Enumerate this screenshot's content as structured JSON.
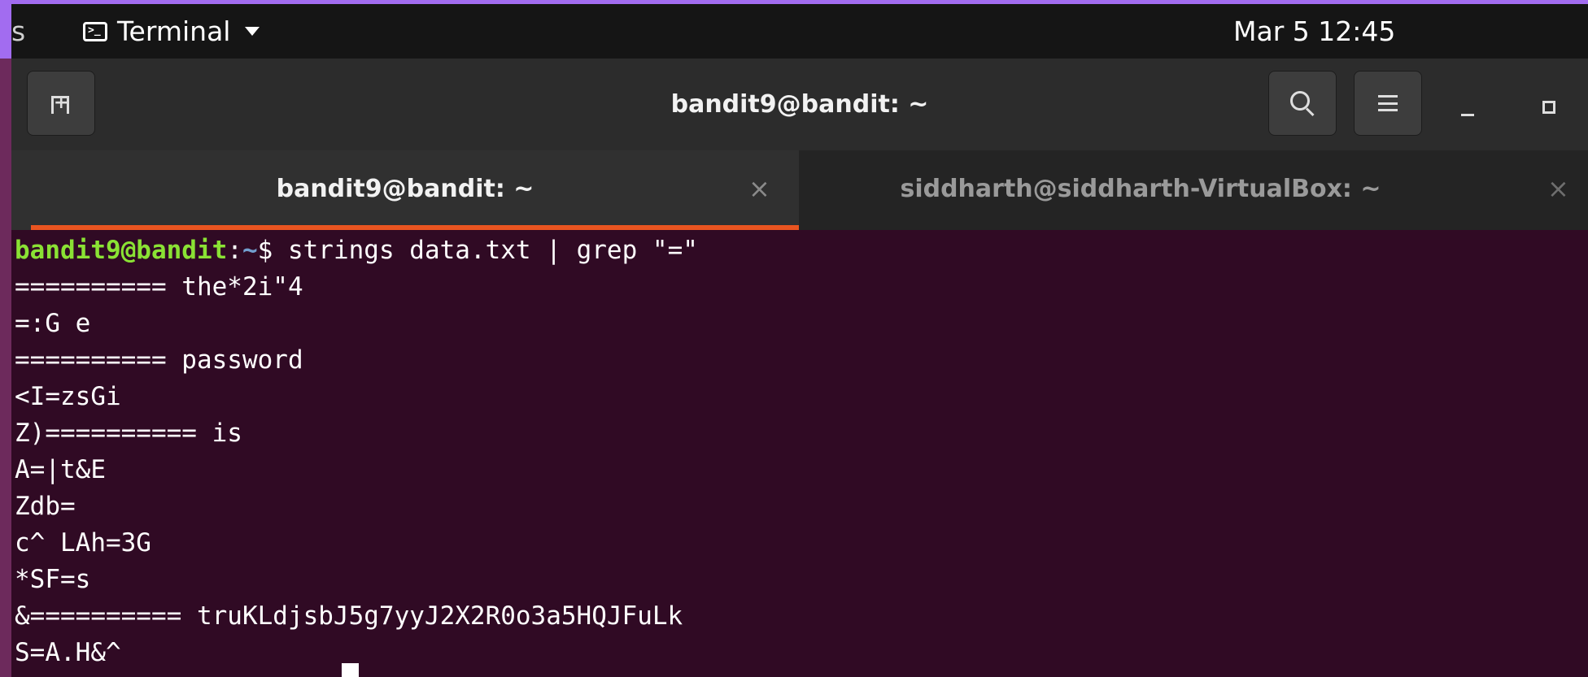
{
  "top_panel": {
    "edge_text": "s",
    "app_menu_label": "Terminal",
    "clock": "Mar 5  12:45"
  },
  "window": {
    "title": "bandit9@bandit: ~"
  },
  "tabs": [
    {
      "label": "bandit9@bandit: ~",
      "close": "×",
      "active": true
    },
    {
      "label": "siddharth@siddharth-VirtualBox: ~",
      "close": "×",
      "active": false
    }
  ],
  "terminal": {
    "prompt_user": "bandit9@bandit",
    "prompt_sep": ":",
    "prompt_path": "~",
    "prompt_symbol": "$",
    "command": " strings data.txt | grep \"=\"",
    "output": [
      "========== the*2i\"4",
      "=:G e",
      "========== password",
      "<I=zsGi",
      "Z)========== is",
      "A=|t&E",
      "Zdb=",
      "c^ LAh=3G",
      "*SF=s",
      "&========== truKLdjsbJ5g7yyJ2X2R0o3a5HQJFuLk",
      "S=A.H&^"
    ]
  },
  "icons": {
    "terminal": "terminal-icon",
    "new_tab": "new-tab-icon",
    "search": "search-icon",
    "menu": "hamburger-menu-icon",
    "minimize": "minimize-icon",
    "maximize": "maximize-icon"
  },
  "colors": {
    "terminal_bg": "#300a24",
    "prompt_user": "#8ae234",
    "prompt_path": "#729fcf",
    "tab_indicator": "#e95420",
    "desktop": "#a26cf0"
  }
}
